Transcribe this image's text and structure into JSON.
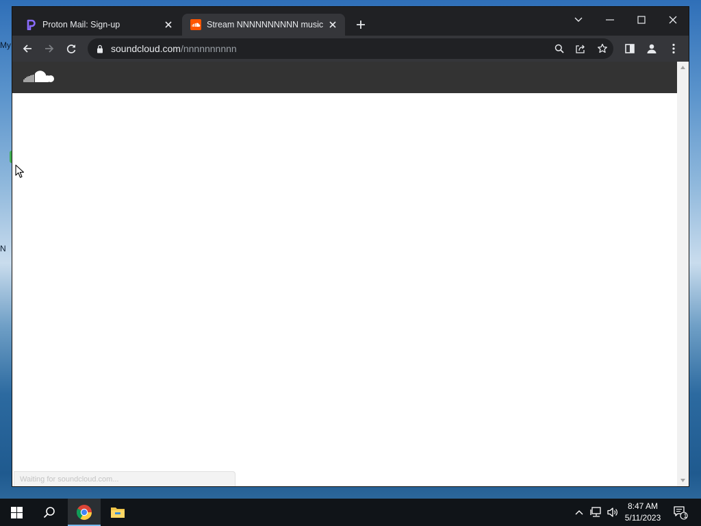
{
  "desktop": {
    "fragments": [
      "My",
      "N"
    ]
  },
  "browser": {
    "tabs": [
      {
        "title": "Proton Mail: Sign-up",
        "icon": "proton-icon",
        "active": false
      },
      {
        "title": "Stream NNNNNNNNNN music |",
        "icon": "soundcloud-favicon",
        "active": true
      }
    ],
    "url": {
      "host": "soundcloud.com",
      "path": "/nnnnnnnnnn"
    },
    "status_text": "Waiting for soundcloud.com..."
  },
  "colors": {
    "soundcloud_orange": "#ff5500",
    "proton_purple": "#6d4aff",
    "header_dark": "#333333"
  },
  "taskbar": {
    "time": "8:47 AM",
    "date": "5/11/2023",
    "notification_count": "1"
  }
}
